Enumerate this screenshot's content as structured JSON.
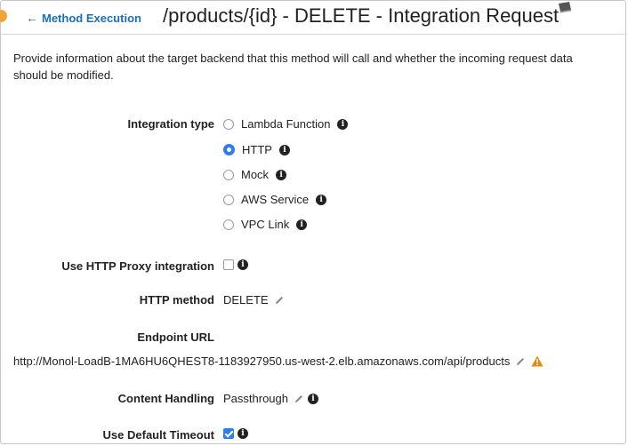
{
  "header": {
    "back_link": "Method Execution",
    "title": "/products/{id} - DELETE - Integration Request"
  },
  "intro": "Provide information about the target backend that this method will call and whether the incoming request data should be modified.",
  "integration_type": {
    "label": "Integration type",
    "options": [
      {
        "label": "Lambda Function",
        "selected": false
      },
      {
        "label": "HTTP",
        "selected": true
      },
      {
        "label": "Mock",
        "selected": false
      },
      {
        "label": "AWS Service",
        "selected": false
      },
      {
        "label": "VPC Link",
        "selected": false
      }
    ]
  },
  "http_proxy": {
    "label": "Use HTTP Proxy integration",
    "checked": false
  },
  "http_method": {
    "label": "HTTP method",
    "value": "DELETE"
  },
  "endpoint": {
    "label": "Endpoint URL",
    "value": "http://Monol-LoadB-1MA6HU6QHEST8-1183927950.us-west-2.elb.amazonaws.com/api/products"
  },
  "content_handling": {
    "label": "Content Handling",
    "value": "Passthrough"
  },
  "default_timeout": {
    "label": "Use Default Timeout",
    "checked": true
  },
  "colors": {
    "link": "#1a6fb5",
    "accent": "#2f7ee8",
    "warning": "#e8870e"
  },
  "icons": {
    "info": "info-icon",
    "edit": "pencil-icon",
    "warning": "warning-icon",
    "back": "arrow-left-icon",
    "docs": "book-icon"
  }
}
